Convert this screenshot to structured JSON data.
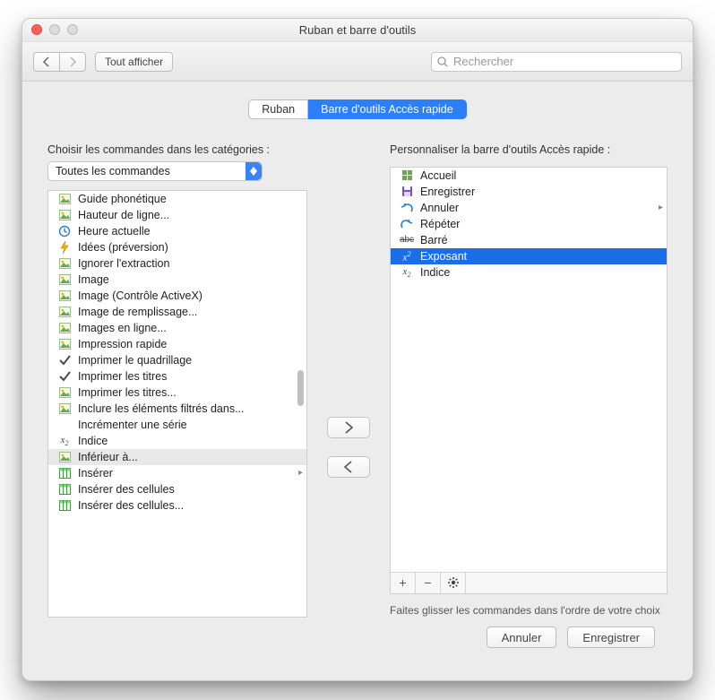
{
  "window": {
    "title": "Ruban et barre d'outils"
  },
  "toolbar": {
    "back": "‹",
    "forward": "›",
    "show_all": "Tout afficher",
    "search_placeholder": "Rechercher"
  },
  "tabs": {
    "ribbon": "Ruban",
    "qat": "Barre d'outils Accès rapide",
    "active": "qat"
  },
  "left": {
    "heading": "Choisir les commandes dans les catégories :",
    "select_value": "Toutes les commandes",
    "items": [
      {
        "icon": "blue-a",
        "label": "Guide phonétique"
      },
      {
        "icon": "row-h",
        "label": "Hauteur de ligne..."
      },
      {
        "icon": "clock",
        "label": "Heure actuelle"
      },
      {
        "icon": "bolt",
        "label": "Idées (préversion)"
      },
      {
        "icon": "block",
        "label": "Ignorer l'extraction"
      },
      {
        "icon": "img",
        "label": "Image"
      },
      {
        "icon": "img",
        "label": "Image (Contrôle ActiveX)"
      },
      {
        "icon": "img",
        "label": "Image de remplissage..."
      },
      {
        "icon": "img-online",
        "label": "Images en ligne..."
      },
      {
        "icon": "printer",
        "label": "Impression rapide"
      },
      {
        "icon": "check",
        "label": "Imprimer le quadrillage"
      },
      {
        "icon": "check",
        "label": "Imprimer les titres"
      },
      {
        "icon": "titles",
        "label": "Imprimer les titres..."
      },
      {
        "icon": "filter",
        "label": "Inclure les éléments filtrés dans..."
      },
      {
        "icon": "blank",
        "label": "Incrémenter une série"
      },
      {
        "icon": "x2",
        "label": "Indice"
      },
      {
        "icon": "ltlt",
        "label": "Inférieur à...",
        "selected": true
      },
      {
        "icon": "insert",
        "label": "Insérer",
        "chev": true
      },
      {
        "icon": "insert",
        "label": "Insérer des cellules"
      },
      {
        "icon": "insert",
        "label": "Insérer des cellules..."
      }
    ]
  },
  "right": {
    "heading": "Personnaliser la barre d'outils Accès rapide :",
    "items": [
      {
        "icon": "grid",
        "label": "Accueil"
      },
      {
        "icon": "save",
        "label": "Enregistrer"
      },
      {
        "icon": "undo",
        "label": "Annuler",
        "chev": true
      },
      {
        "icon": "redo",
        "label": "Répéter"
      },
      {
        "icon": "strike",
        "label": "Barré"
      },
      {
        "icon": "x-sup",
        "label": "Exposant",
        "selected": true
      },
      {
        "icon": "x2",
        "label": "Indice"
      }
    ],
    "hint": "Faites glisser les commandes dans l'ordre de votre choix",
    "addbar": {
      "plus": "+",
      "minus": "−",
      "gear": "✱"
    }
  },
  "buttons": {
    "move_right": "›",
    "move_left": "‹"
  },
  "footer": {
    "cancel": "Annuler",
    "save": "Enregistrer"
  }
}
